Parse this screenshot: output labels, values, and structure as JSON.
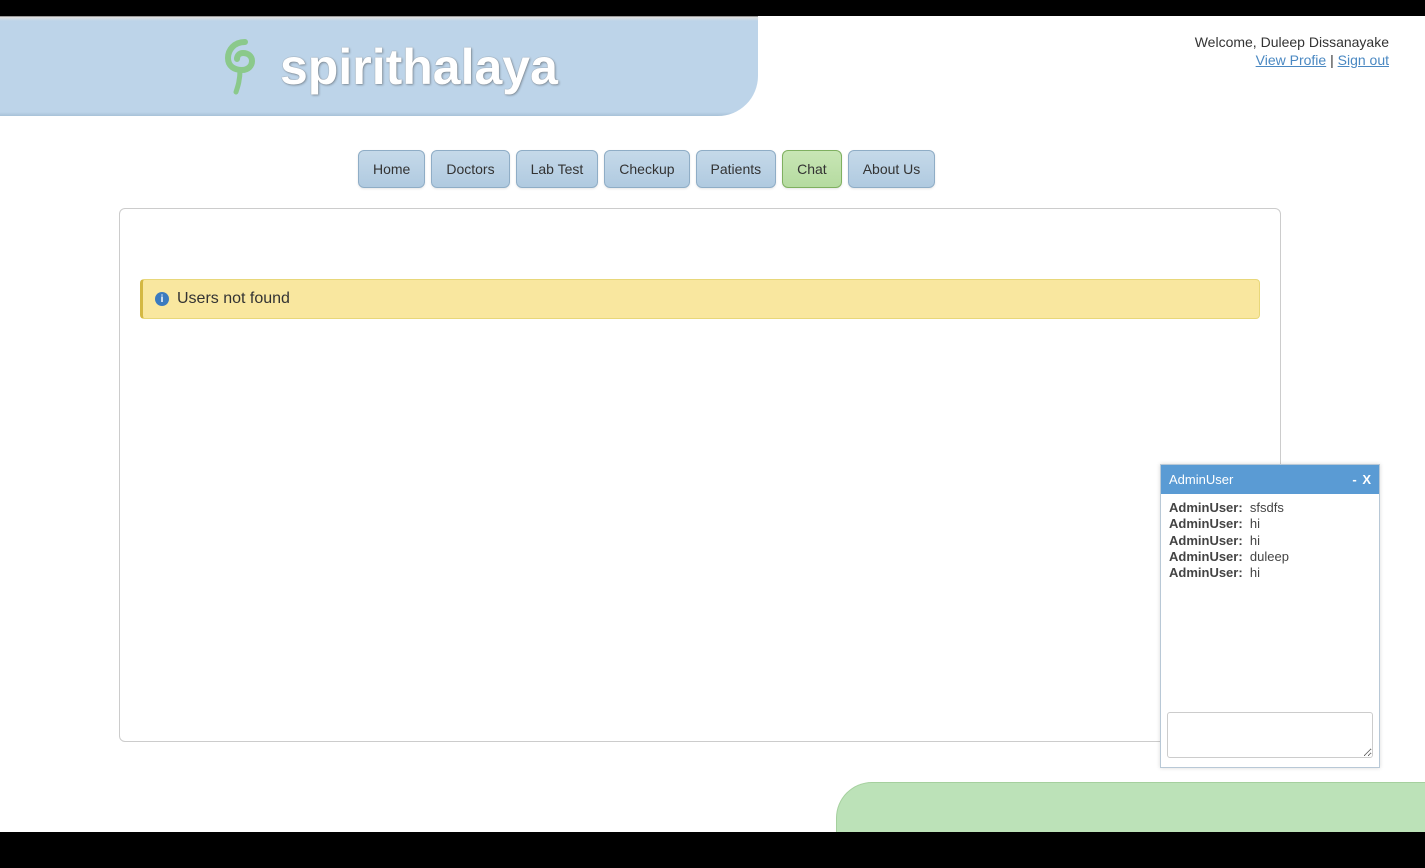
{
  "brand": {
    "name": "spirithalaya"
  },
  "user": {
    "welcome_prefix": "Welcome, ",
    "name": "Duleep Dissanayake",
    "view_profile": "View Profie",
    "separator": " | ",
    "sign_out": "Sign out"
  },
  "nav": {
    "home": "Home",
    "doctors": "Doctors",
    "lab_test": "Lab Test",
    "checkup": "Checkup",
    "patients": "Patients",
    "chat": "Chat",
    "about_us": "About Us"
  },
  "alert": {
    "icon_label": "i",
    "message": "Users not found"
  },
  "chat": {
    "title": "AdminUser",
    "minimize": "-",
    "close": "X",
    "messages": [
      {
        "sender": "AdminUser:",
        "text": "sfsdfs"
      },
      {
        "sender": "AdminUser:",
        "text": "hi"
      },
      {
        "sender": "AdminUser:",
        "text": "hi"
      },
      {
        "sender": "AdminUser:",
        "text": "duleep"
      },
      {
        "sender": "AdminUser:",
        "text": "hi"
      }
    ],
    "input_value": ""
  }
}
